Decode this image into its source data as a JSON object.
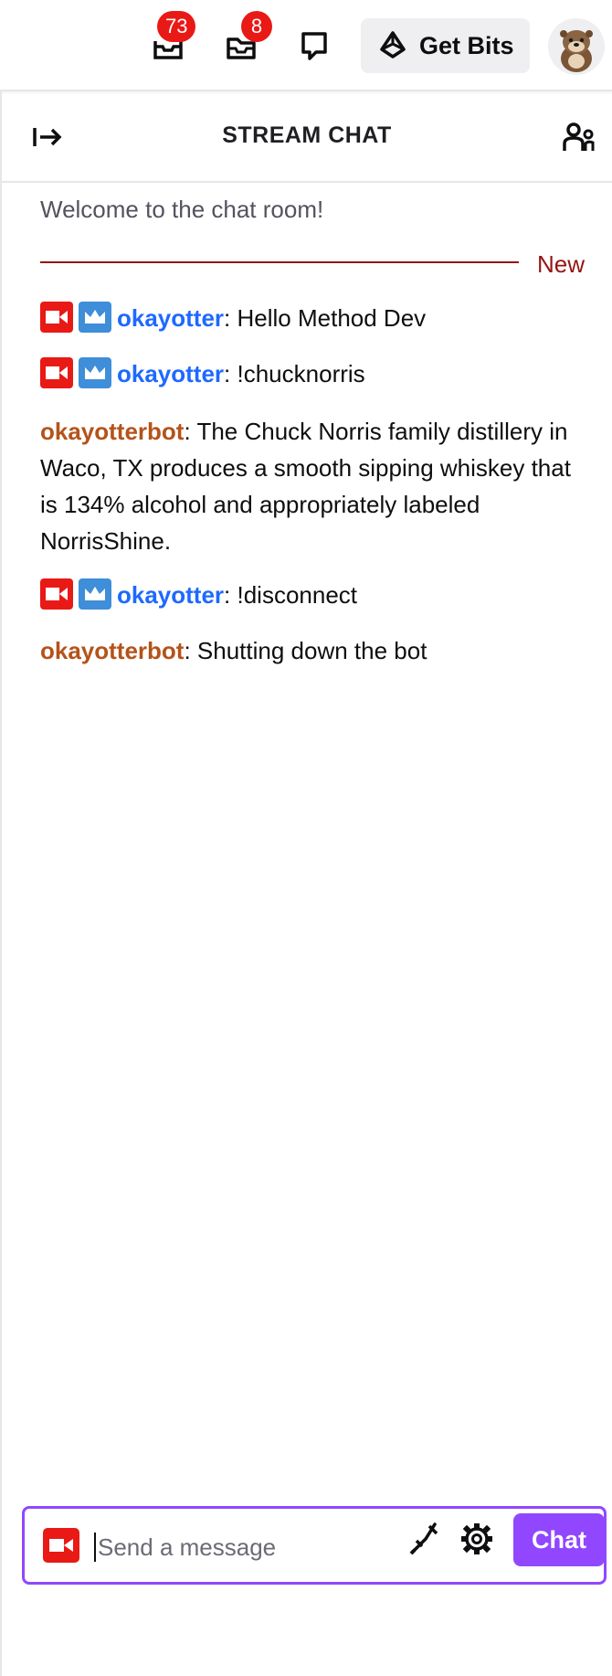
{
  "topnav": {
    "inbox": {
      "icon": "inbox-icon",
      "count": "73"
    },
    "drops": {
      "icon": "drops-icon",
      "count": "8"
    },
    "whispers": {
      "icon": "whispers-icon"
    },
    "get_bits": {
      "icon": "bits-icon",
      "label": "Get Bits"
    },
    "avatar": {
      "icon": "otter-avatar"
    }
  },
  "chat": {
    "title": "STREAM CHAT",
    "collapse_icon": "collapse-arrow-icon",
    "users_icon": "community-icon",
    "welcome": "Welcome to the chat room!",
    "new_label": "New",
    "messages": [
      {
        "user": "okayotter",
        "sep": ": ",
        "text": "Hello Method Dev",
        "badges": [
          "broadcaster-badge",
          "moderator-badge"
        ],
        "color": "#1e69ff"
      },
      {
        "user": "okayotter",
        "sep": ": ",
        "text": "!chucknorris",
        "badges": [
          "broadcaster-badge",
          "moderator-badge"
        ],
        "color": "#1e69ff"
      },
      {
        "user": "okayotterbot",
        "sep": ": ",
        "text": "The Chuck Norris family distillery in Waco, TX produces a smooth sipping whiskey that is 134% alcohol and appropriately labeled NorrisShine.",
        "badges": [],
        "color": "#b4531a"
      },
      {
        "user": "okayotter",
        "sep": ": ",
        "text": "!disconnect",
        "badges": [
          "broadcaster-badge",
          "moderator-badge"
        ],
        "color": "#1e69ff"
      },
      {
        "user": "okayotterbot",
        "sep": ": ",
        "text": "Shutting down the bot",
        "badges": [],
        "color": "#b4531a"
      }
    ],
    "input": {
      "placeholder": "Send a message",
      "value": ""
    },
    "send_label": "Chat"
  },
  "colors": {
    "accent": "#9147ff",
    "badge_red": "#e91916",
    "badge_blue": "#3e8ed9",
    "divider_red": "#971311"
  }
}
